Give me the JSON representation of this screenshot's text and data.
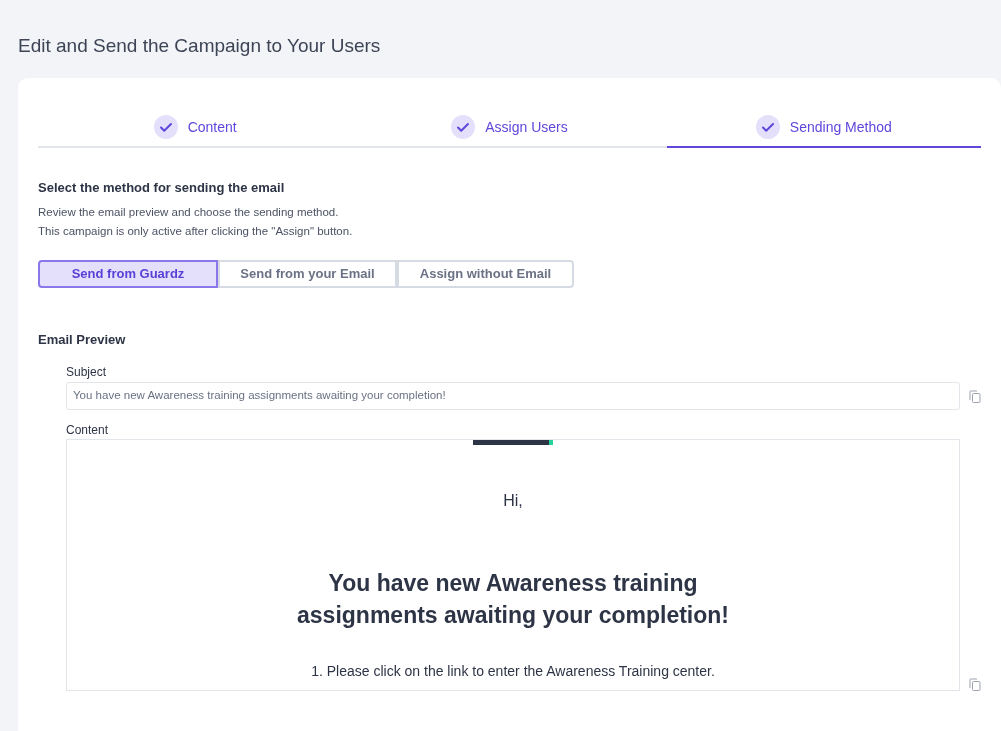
{
  "page_title": "Edit and Send the Campaign to Your Users",
  "steps": [
    {
      "label": "Content",
      "done": true,
      "selected": false
    },
    {
      "label": "Assign Users",
      "done": true,
      "selected": false
    },
    {
      "label": "Sending Method",
      "done": true,
      "selected": true
    }
  ],
  "section": {
    "title": "Select the method for sending the email",
    "lines": [
      "Review the email preview and choose the sending method.",
      "This campaign is only active after clicking the \"Assign\" button."
    ]
  },
  "methods": [
    {
      "label": "Send from Guardz",
      "selected": true
    },
    {
      "label": "Send from your Email",
      "selected": false
    },
    {
      "label": "Assign without Email",
      "selected": false
    }
  ],
  "preview": {
    "title": "Email Preview",
    "subject_label": "Subject",
    "subject": "You have new Awareness training assignments awaiting your completion!",
    "content_label": "Content",
    "greeting": "Hi,",
    "headline": "You have new Awareness training assignments awaiting your completion!",
    "step_1": "1. Please click on the link to enter the Awareness Training center."
  }
}
